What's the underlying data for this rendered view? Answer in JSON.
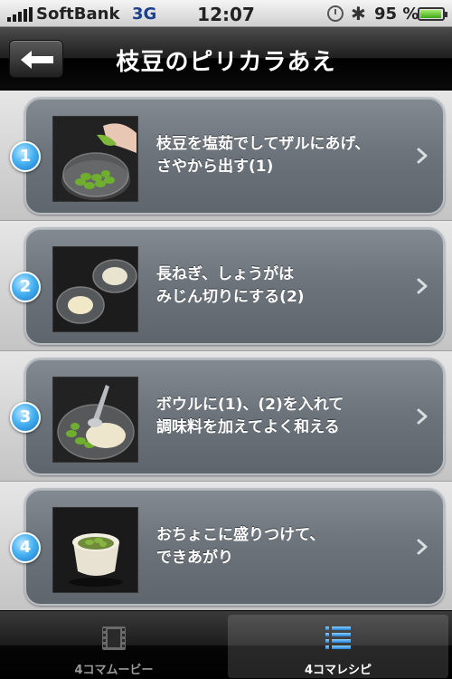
{
  "status_bar": {
    "carrier": "SoftBank",
    "network": "3G",
    "time": "12:07",
    "battery_percent": "95 %",
    "battery_level": 0.95,
    "icons": [
      "signal-bars-icon",
      "rotation-lock-icon",
      "bluetooth-icon",
      "battery-icon"
    ]
  },
  "nav": {
    "title": "枝豆のピリカラあえ",
    "back_icon": "back-arrow-icon"
  },
  "steps": [
    {
      "number": "1",
      "line1": "枝豆を塩茹でしてザルにあげ、",
      "line2": "さやから出す(1)"
    },
    {
      "number": "2",
      "line1": "長ねぎ、しょうがは",
      "line2": "みじん切りにする(2)"
    },
    {
      "number": "3",
      "line1": "ボウルに(1)、(2)を入れて",
      "line2": "調味料を加えてよく和える"
    },
    {
      "number": "4",
      "line1": "おちょこに盛りつけて、",
      "line2": "できあがり"
    }
  ],
  "tabs": [
    {
      "label": "4コマムービー",
      "icon": "film-icon",
      "active": false
    },
    {
      "label": "4コマレシピ",
      "icon": "list-icon",
      "active": true
    }
  ],
  "colors": {
    "badge": "#2e95e0",
    "card": "#6d747c",
    "active_tab_label": "#ffffff",
    "inactive_tab_label": "#9a9a9a"
  }
}
